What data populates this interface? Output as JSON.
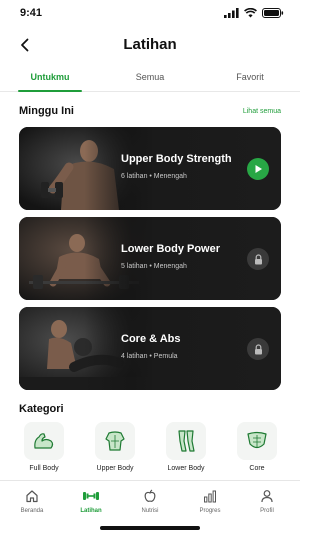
{
  "status_bar": {
    "time": "9:41"
  },
  "header": {
    "title": "Latihan"
  },
  "tabs": [
    {
      "label": "Untukmu",
      "active": true
    },
    {
      "label": "Semua",
      "active": false
    },
    {
      "label": "Favorit",
      "active": false
    }
  ],
  "weekly": {
    "title": "Minggu Ini",
    "see_all": "Lihat semua",
    "workouts": [
      {
        "title": "Upper Body Strength",
        "meta": "6 latihan • Menengah",
        "action": "play-icon"
      },
      {
        "title": "Lower Body Power",
        "meta": "5 latihan • Menengah",
        "action": "lock-icon"
      },
      {
        "title": "Core & Abs",
        "meta": "4 latihan • Pemula",
        "action": "lock-icon"
      }
    ]
  },
  "categories": {
    "title": "Kategori",
    "items": [
      {
        "label": "Full Body",
        "icon": "flexed-arm-icon"
      },
      {
        "label": "Upper Body",
        "icon": "torso-icon"
      },
      {
        "label": "Lower Body",
        "icon": "legs-icon"
      },
      {
        "label": "Core",
        "icon": "abs-icon"
      }
    ]
  },
  "bottom_nav": [
    {
      "label": "Beranda",
      "icon": "home-icon",
      "active": false
    },
    {
      "label": "Latihan",
      "icon": "dumbbell-icon",
      "active": true
    },
    {
      "label": "Nutrisi",
      "icon": "apple-icon",
      "active": false
    },
    {
      "label": "Progres",
      "icon": "bar-chart-icon",
      "active": false
    },
    {
      "label": "Profil",
      "icon": "user-icon",
      "active": false
    }
  ],
  "colors": {
    "accent": "#1f9d3a",
    "card_bg": "#1c1c1c",
    "category_bg": "#f3f5f3"
  }
}
